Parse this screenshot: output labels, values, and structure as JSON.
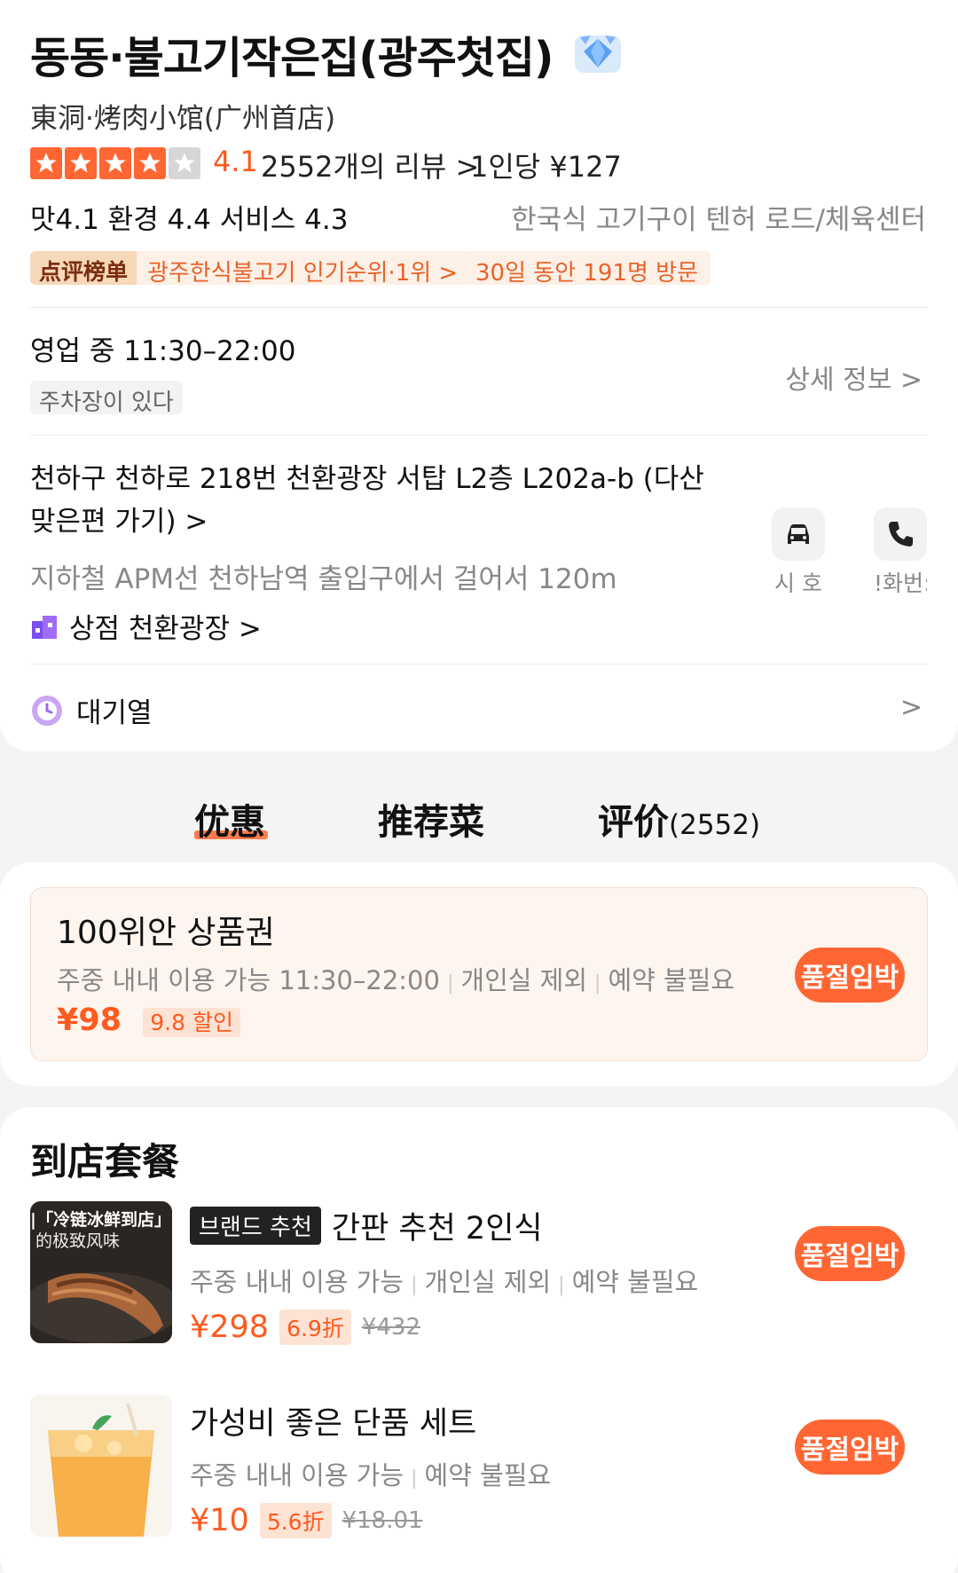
{
  "shop": {
    "title": "동동·불고기작은집(광주첫집)",
    "subtitle": "東洞·烤肉小馆(广州首店)",
    "rating": "4.1",
    "reviews": "2552개의 리뷰 >",
    "price_per_person": "1인당 ¥127",
    "scores": "맛4.1  환경 4.4  서비스 4.3",
    "category": "한국식 고기구이  텐허 로드/체육센터",
    "rank_logo": "点评榜单",
    "rank_text": "광주한식불고기 인기순위·1위 >",
    "visits": "30일 동안 191명 방문",
    "hours": "영업 중  11:30–22:00",
    "parking": "주차장이 있다",
    "detail_link": "상세 정보 >",
    "address": "천하구 천하로 218번 천환광장 서탑 L2층 L202a-b (다산 맞은편 가기) >",
    "subway": "지하철 APM선 천하남역 출입구에서 걸어서 120m",
    "mall": "상점 천환광장 >",
    "car_label": "시 호",
    "phone_label": "!화번:",
    "queue": "대기열",
    "queue_chevron": ">"
  },
  "tabs": {
    "offers": "优惠",
    "dishes": "推荐菜",
    "reviews": "评价",
    "reviews_count": "(2552)"
  },
  "voucher": {
    "title": "100위안 상품권",
    "desc_1": "주중 내내 이용 가능 11:30–22:00",
    "desc_2": "개인실 제외",
    "desc_3": "예약 불필요",
    "price": "¥98",
    "discount": "9.8 할인",
    "button": "품절임박"
  },
  "packages": {
    "section_title": "到店套餐",
    "items": [
      {
        "badge": "브랜드 추천",
        "title": "간판 추천 2인식",
        "desc_1": "주중 내내 이용 가능",
        "desc_2": "개인실 제외",
        "desc_3": "예약 불필요",
        "price": "¥298",
        "discount": "6.9折",
        "old_price": "¥432",
        "button": "품절임박",
        "thumb_text_1": "|「冷链冰鲜到店」",
        "thumb_text_2": "的极致风味"
      },
      {
        "title": "가성비 좋은 단품 세트",
        "desc_1": "주중 내내 이용 가능",
        "desc_2": "예약 불필요",
        "price": "¥10",
        "discount": "5.6折",
        "old_price": "¥18.01",
        "button": "품절임박"
      }
    ]
  },
  "colors": {
    "accent": "#ff6633",
    "price": "#ff5a1f",
    "muted": "#888888",
    "tag_bg": "#fdf0e6"
  }
}
